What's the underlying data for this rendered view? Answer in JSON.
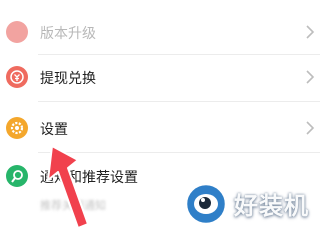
{
  "menu": {
    "items": [
      {
        "label": "版本升级",
        "icon": "upgrade-icon"
      },
      {
        "label": "提现兑换",
        "icon": "withdraw-icon"
      },
      {
        "label": "设置",
        "icon": "gear-icon"
      },
      {
        "label": "通知和推荐设置",
        "icon": "notification-icon",
        "sublabel": "推荐关闭通知"
      }
    ]
  },
  "annotation": {
    "icon": "pointer-arrow",
    "color": "#f1414d"
  },
  "watermark": {
    "text": "好装机",
    "icon": "eye-logo"
  }
}
